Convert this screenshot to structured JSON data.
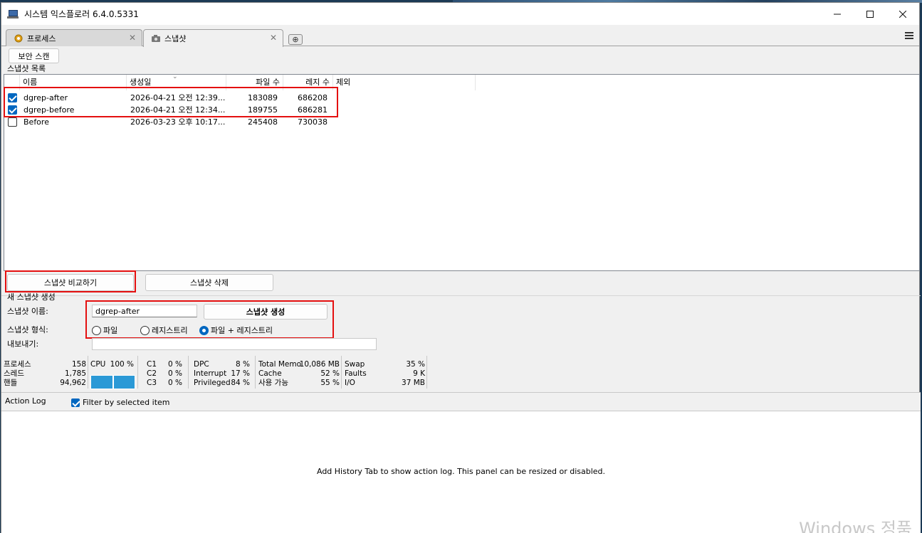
{
  "window": {
    "title": "시스템 익스플로러 6.4.0.5331"
  },
  "tabs": [
    {
      "label": "프로세스",
      "active": false
    },
    {
      "label": "스냅샷",
      "active": true
    }
  ],
  "toolbar": {
    "security_scan_label": "보안 스캔"
  },
  "snapshot_list": {
    "section_label": "스냅샷 목록",
    "columns": [
      "이름",
      "생성일",
      "파일 수",
      "레지 수",
      "제외"
    ],
    "rows": [
      {
        "checked": true,
        "name": "dgrep-after",
        "created": "2026-04-21 오전 12:39...",
        "files": "183089",
        "registry": "686208"
      },
      {
        "checked": true,
        "name": "dgrep-before",
        "created": "2026-04-21 오전 12:34...",
        "files": "189755",
        "registry": "686281"
      },
      {
        "checked": false,
        "name": "Before",
        "created": "2026-03-23 오후 10:17...",
        "files": "245408",
        "registry": "730038"
      }
    ]
  },
  "actions": {
    "compare_label": "스냅샷 비교하기",
    "delete_label": "스냅샷 삭제"
  },
  "new_snapshot": {
    "section_label": "새 스냅샷 생성",
    "name_label": "스냅샷 이름:",
    "name_value": "dgrep-after",
    "create_label": "스냅샷 생성",
    "type_label": "스냅샷 형식:",
    "type_options": [
      "파일",
      "레지스트리",
      "파일 + 레지스트리"
    ],
    "type_selected": "파일 + 레지스트리",
    "export_label": "내보내기:",
    "export_value": ""
  },
  "stats": {
    "processes_label": "프로세스",
    "processes": "158",
    "threads_label": "스레드",
    "threads": "1,785",
    "handles_label": "핸들",
    "handles": "94,962",
    "cpu_label": "CPU",
    "cpu": "100 %",
    "cpu_level": 1.0,
    "c1_label": "C1",
    "c1": "0 %",
    "c2_label": "C2",
    "c2": "0 %",
    "c3_label": "C3",
    "c3": "0 %",
    "dpc_label": "DPC",
    "dpc": "8 %",
    "interrupt_label": "Interrupt",
    "interrupt": "17 %",
    "privileged_label": "Privileged",
    "privileged": "84 %",
    "total_memory_label": "Total Memo",
    "total_memory": "10,086 MB",
    "cache_label": "Cache",
    "cache": "52 %",
    "available_label": "사용 가능",
    "available": "55 %",
    "swap_label": "Swap",
    "swap": "35 %",
    "faults_label": "Faults",
    "faults": "9 K",
    "io_label": "I/O",
    "io": "37 MB"
  },
  "action_log": {
    "title": "Action Log",
    "filter_label": "Filter by selected item",
    "filter_checked": true,
    "empty_message": "Add History Tab to show action log.  This panel can be resized or disabled."
  },
  "watermark": "Windows 정품",
  "colors": {
    "highlight_red": "#e41010",
    "accent_blue": "#0067c0",
    "cpu_graph": "#2b99d6"
  }
}
